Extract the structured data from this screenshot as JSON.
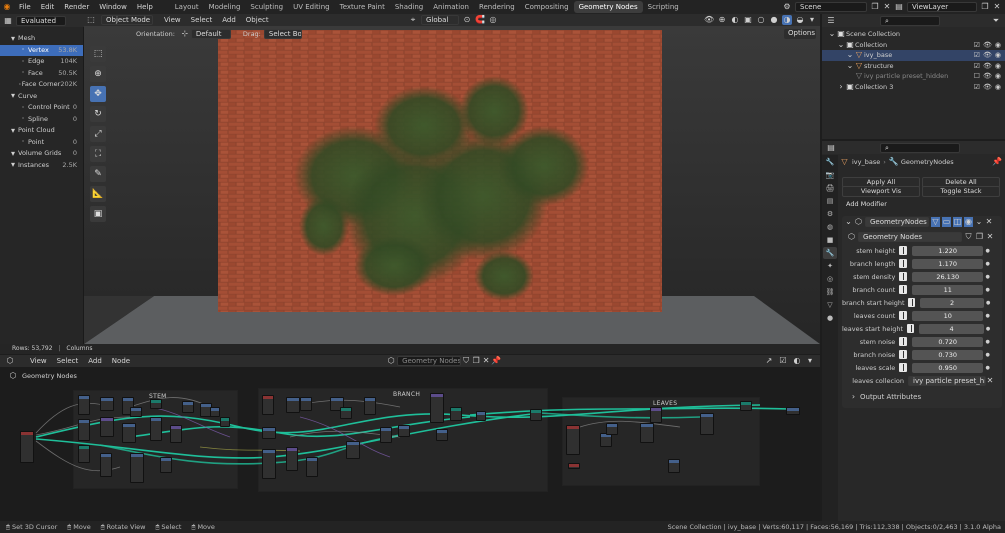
{
  "topbar": {
    "menus": [
      "File",
      "Edit",
      "Render",
      "Window",
      "Help"
    ],
    "workspaces": [
      "Layout",
      "Modeling",
      "Sculpting",
      "UV Editing",
      "Texture Paint",
      "Shading",
      "Animation",
      "Rendering",
      "Compositing",
      "Geometry Nodes",
      "Scripting"
    ],
    "active_workspace": "Geometry Nodes",
    "scene": "Scene",
    "view_layer": "ViewLayer"
  },
  "spreadsheet": {
    "mode": "Evaluated",
    "items": [
      {
        "label": "Mesh",
        "count": "",
        "indent": 0
      },
      {
        "label": "Vertex",
        "count": "53.8K",
        "indent": 1,
        "selected": true
      },
      {
        "label": "Edge",
        "count": "104K",
        "indent": 1
      },
      {
        "label": "Face",
        "count": "50.5K",
        "indent": 1
      },
      {
        "label": "Face Corner",
        "count": "202K",
        "indent": 1
      },
      {
        "label": "Curve",
        "count": "",
        "indent": 0
      },
      {
        "label": "Control Point",
        "count": "0",
        "indent": 1
      },
      {
        "label": "Spline",
        "count": "0",
        "indent": 1
      },
      {
        "label": "Point Cloud",
        "count": "",
        "indent": 0
      },
      {
        "label": "Point",
        "count": "0",
        "indent": 1
      },
      {
        "label": "Volume Grids",
        "count": "0",
        "indent": 0
      },
      {
        "label": "Instances",
        "count": "2.5K",
        "indent": 0
      }
    ],
    "rows_label": "Rows: 53,792",
    "columns_label": "Columns"
  },
  "viewport": {
    "mode": "Object Mode",
    "menus": [
      "View",
      "Select",
      "Add",
      "Object"
    ],
    "transform": "Global",
    "orientation_label": "Orientation:",
    "orientation": "Default",
    "drag_label": "Drag:",
    "drag": "Select Box",
    "options": "Options"
  },
  "node_editor": {
    "menus": [
      "View",
      "Select",
      "Add",
      "Node"
    ],
    "tree_name": "Geometry Nodes",
    "breadcrumb": "Geometry Nodes",
    "frames": [
      "STEM",
      "BRANCH",
      "LEAVES"
    ]
  },
  "outliner": {
    "search_placeholder": "",
    "items": [
      {
        "label": "Scene Collection",
        "indent": 0
      },
      {
        "label": "Collection",
        "indent": 1
      },
      {
        "label": "ivy_base",
        "indent": 2
      },
      {
        "label": "structure",
        "indent": 2
      },
      {
        "label": "ivy particle preset_hidden",
        "indent": 2
      },
      {
        "label": "Collection 3",
        "indent": 1
      }
    ]
  },
  "properties": {
    "breadcrumb_object": "ivy_base",
    "breadcrumb_modifier": "GeometryNodes",
    "apply_all": "Apply All",
    "delete_all": "Delete All",
    "viewport_vis": "Viewport Vis",
    "toggle_stack": "Toggle Stack",
    "add_modifier": "Add Modifier",
    "modifier_name": "GeometryNodes",
    "node_group": "Geometry Nodes",
    "inputs": [
      {
        "label": "stem height",
        "value": "1.220"
      },
      {
        "label": "branch length",
        "value": "1.170"
      },
      {
        "label": "stem density",
        "value": "26.130"
      },
      {
        "label": "branch count",
        "value": "11"
      },
      {
        "label": "branch start height",
        "value": "2"
      },
      {
        "label": "leaves count",
        "value": "10"
      },
      {
        "label": "leaves start height",
        "value": "4"
      },
      {
        "label": "stem noise",
        "value": "0.720"
      },
      {
        "label": "branch noise",
        "value": "0.730"
      },
      {
        "label": "leaves scale",
        "value": "0.950"
      }
    ],
    "collection_label": "leaves collecion",
    "collection_value": "ivy particle preset_hid...",
    "output_attributes": "Output Attributes"
  },
  "footer": {
    "hints": [
      "Set 3D Cursor",
      "Move",
      "Rotate View",
      "Select",
      "Move"
    ],
    "stats": "Scene Collection | ivy_base | Verts:60,117 | Faces:56,169 | Tris:112,338 | Objects:0/2,463 | 3.1.0 Alpha"
  },
  "colors": {
    "accent": "#4772b3",
    "header_bg": "#232323",
    "panel_bg": "#282828",
    "socket_geometry": "#00d6a3"
  }
}
